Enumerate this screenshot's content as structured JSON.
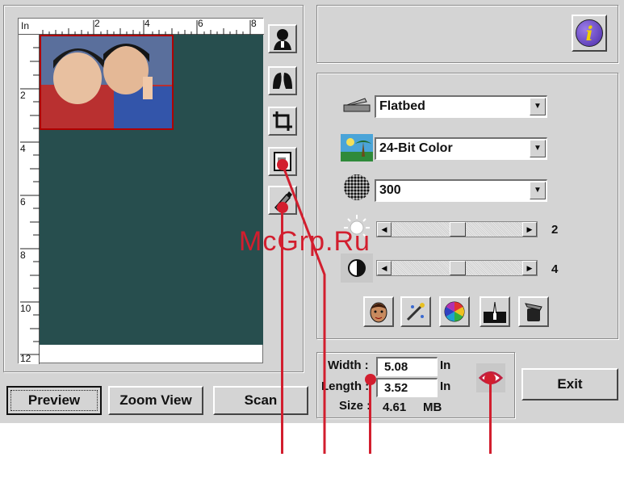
{
  "rulers": {
    "unit": "In",
    "top_ticks": [
      "2",
      "4",
      "6",
      "8"
    ],
    "left_ticks": [
      "2",
      "4",
      "6",
      "8",
      "10",
      "12"
    ]
  },
  "tools": {
    "silhouette_icon": "person-silhouette-icon",
    "mirror_icon": "two-heads-icon",
    "crop_icon": "crop-icon",
    "frame_icon": "frame-select-icon",
    "pen_icon": "pen-icon"
  },
  "buttons": {
    "preview": "Preview",
    "zoom_view": "Zoom View",
    "scan": "Scan",
    "exit": "Exit",
    "info": "i"
  },
  "settings": {
    "source": "Flatbed",
    "mode": "24-Bit Color",
    "resolution": "300",
    "brightness": "2",
    "contrast": "4",
    "brightness_level": 0.5,
    "contrast_level": 0.5
  },
  "size": {
    "width_label": "Width :",
    "width_value": "5.08",
    "width_unit": "In",
    "length_label": "Length :",
    "length_value": "3.52",
    "length_unit": "In",
    "size_label": "Size :",
    "size_value": "4.61",
    "size_unit": "MB"
  },
  "watermark": "McGrp.Ru",
  "colors": {
    "callout": "#d21e2e",
    "preview_bg": "#274e4e",
    "window": "#d4d4d4"
  }
}
